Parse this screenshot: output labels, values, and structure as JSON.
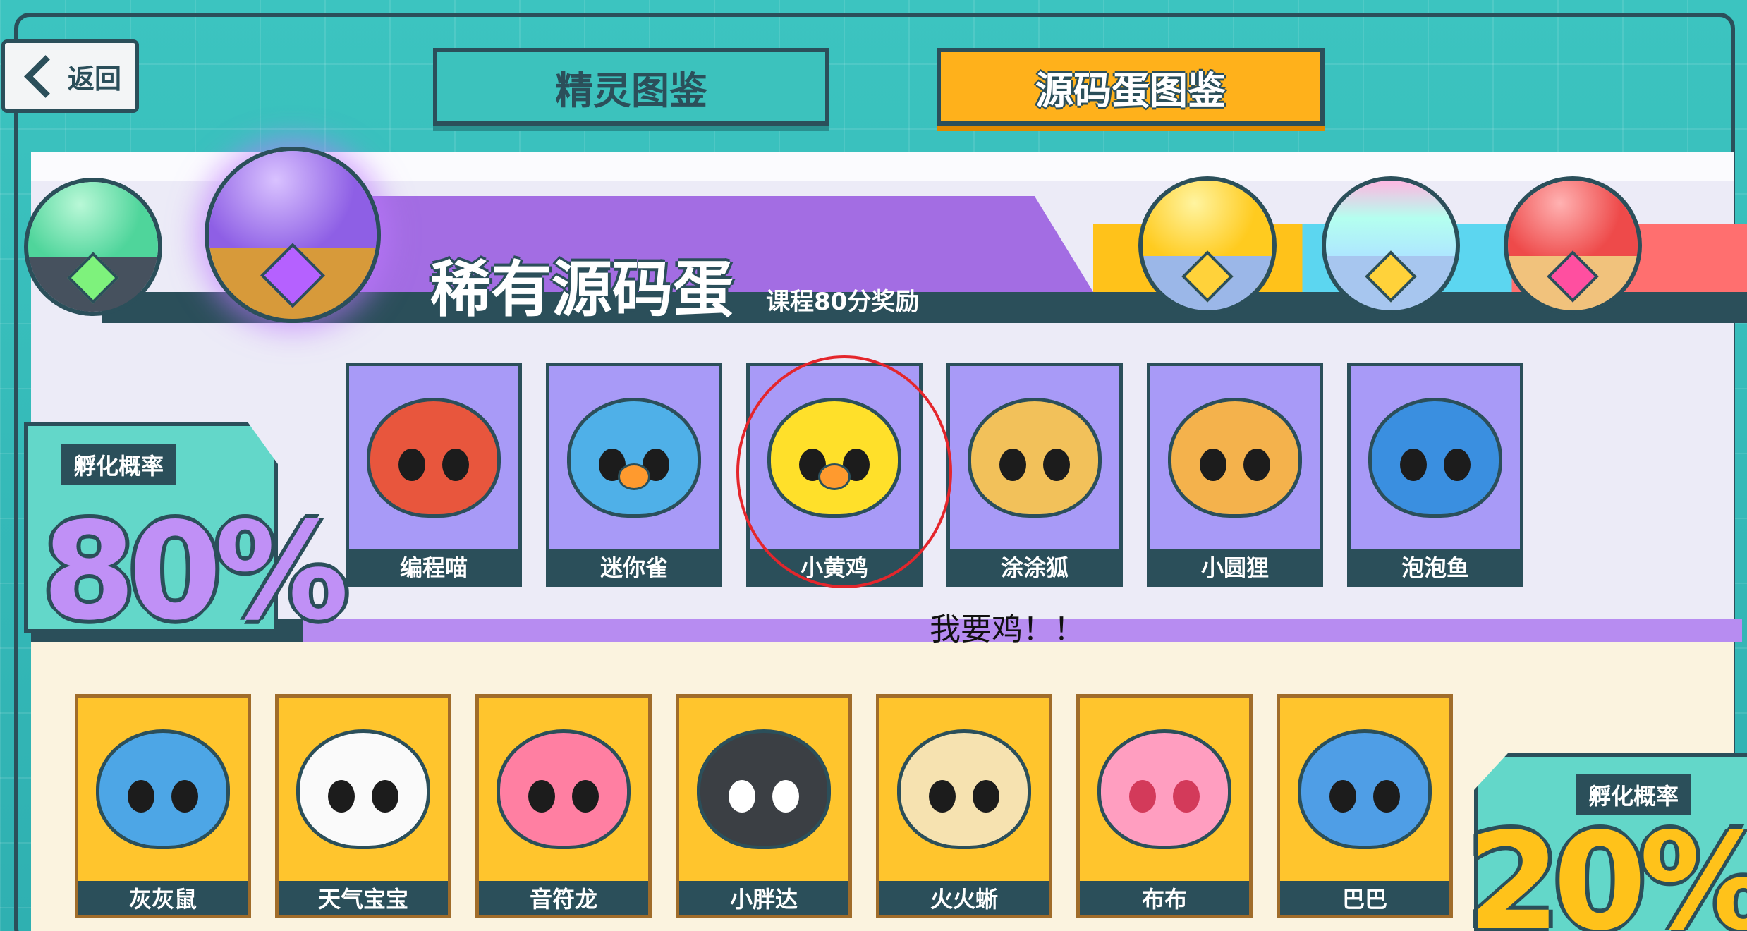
{
  "back_label": "返回",
  "tabs": [
    {
      "label": "精灵图鉴",
      "active": false
    },
    {
      "label": "源码蛋图鉴",
      "active": true
    }
  ],
  "banner": {
    "title": "稀有源码蛋",
    "subtitle": "课程80分奖励"
  },
  "rates": {
    "left": {
      "label": "孵化概率",
      "value": "80%"
    },
    "right": {
      "label": "孵化概率",
      "value": "20%"
    }
  },
  "rare_creatures": [
    {
      "name": "编程喵",
      "color": "#e8563d"
    },
    {
      "name": "迷你雀",
      "color": "#4fb0e8"
    },
    {
      "name": "小黄鸡",
      "color": "#ffe02a"
    },
    {
      "name": "涂涂狐",
      "color": "#f2c15a"
    },
    {
      "name": "小圆狸",
      "color": "#f4b24c"
    },
    {
      "name": "泡泡鱼",
      "color": "#3a8fe0"
    }
  ],
  "common_creatures": [
    {
      "name": "灰灰鼠",
      "color": "#4da6e6"
    },
    {
      "name": "天气宝宝",
      "color": "#fafafa"
    },
    {
      "name": "音符龙",
      "color": "#ff7fa2"
    },
    {
      "name": "小胖达",
      "color": "#3b3f44"
    },
    {
      "name": "火火蜥",
      "color": "#f6e2b0"
    },
    {
      "name": "布布",
      "color": "#ff9ec0"
    },
    {
      "name": "巴巴",
      "color": "#4f9ee6"
    }
  ],
  "annotation": "我要鸡！！"
}
